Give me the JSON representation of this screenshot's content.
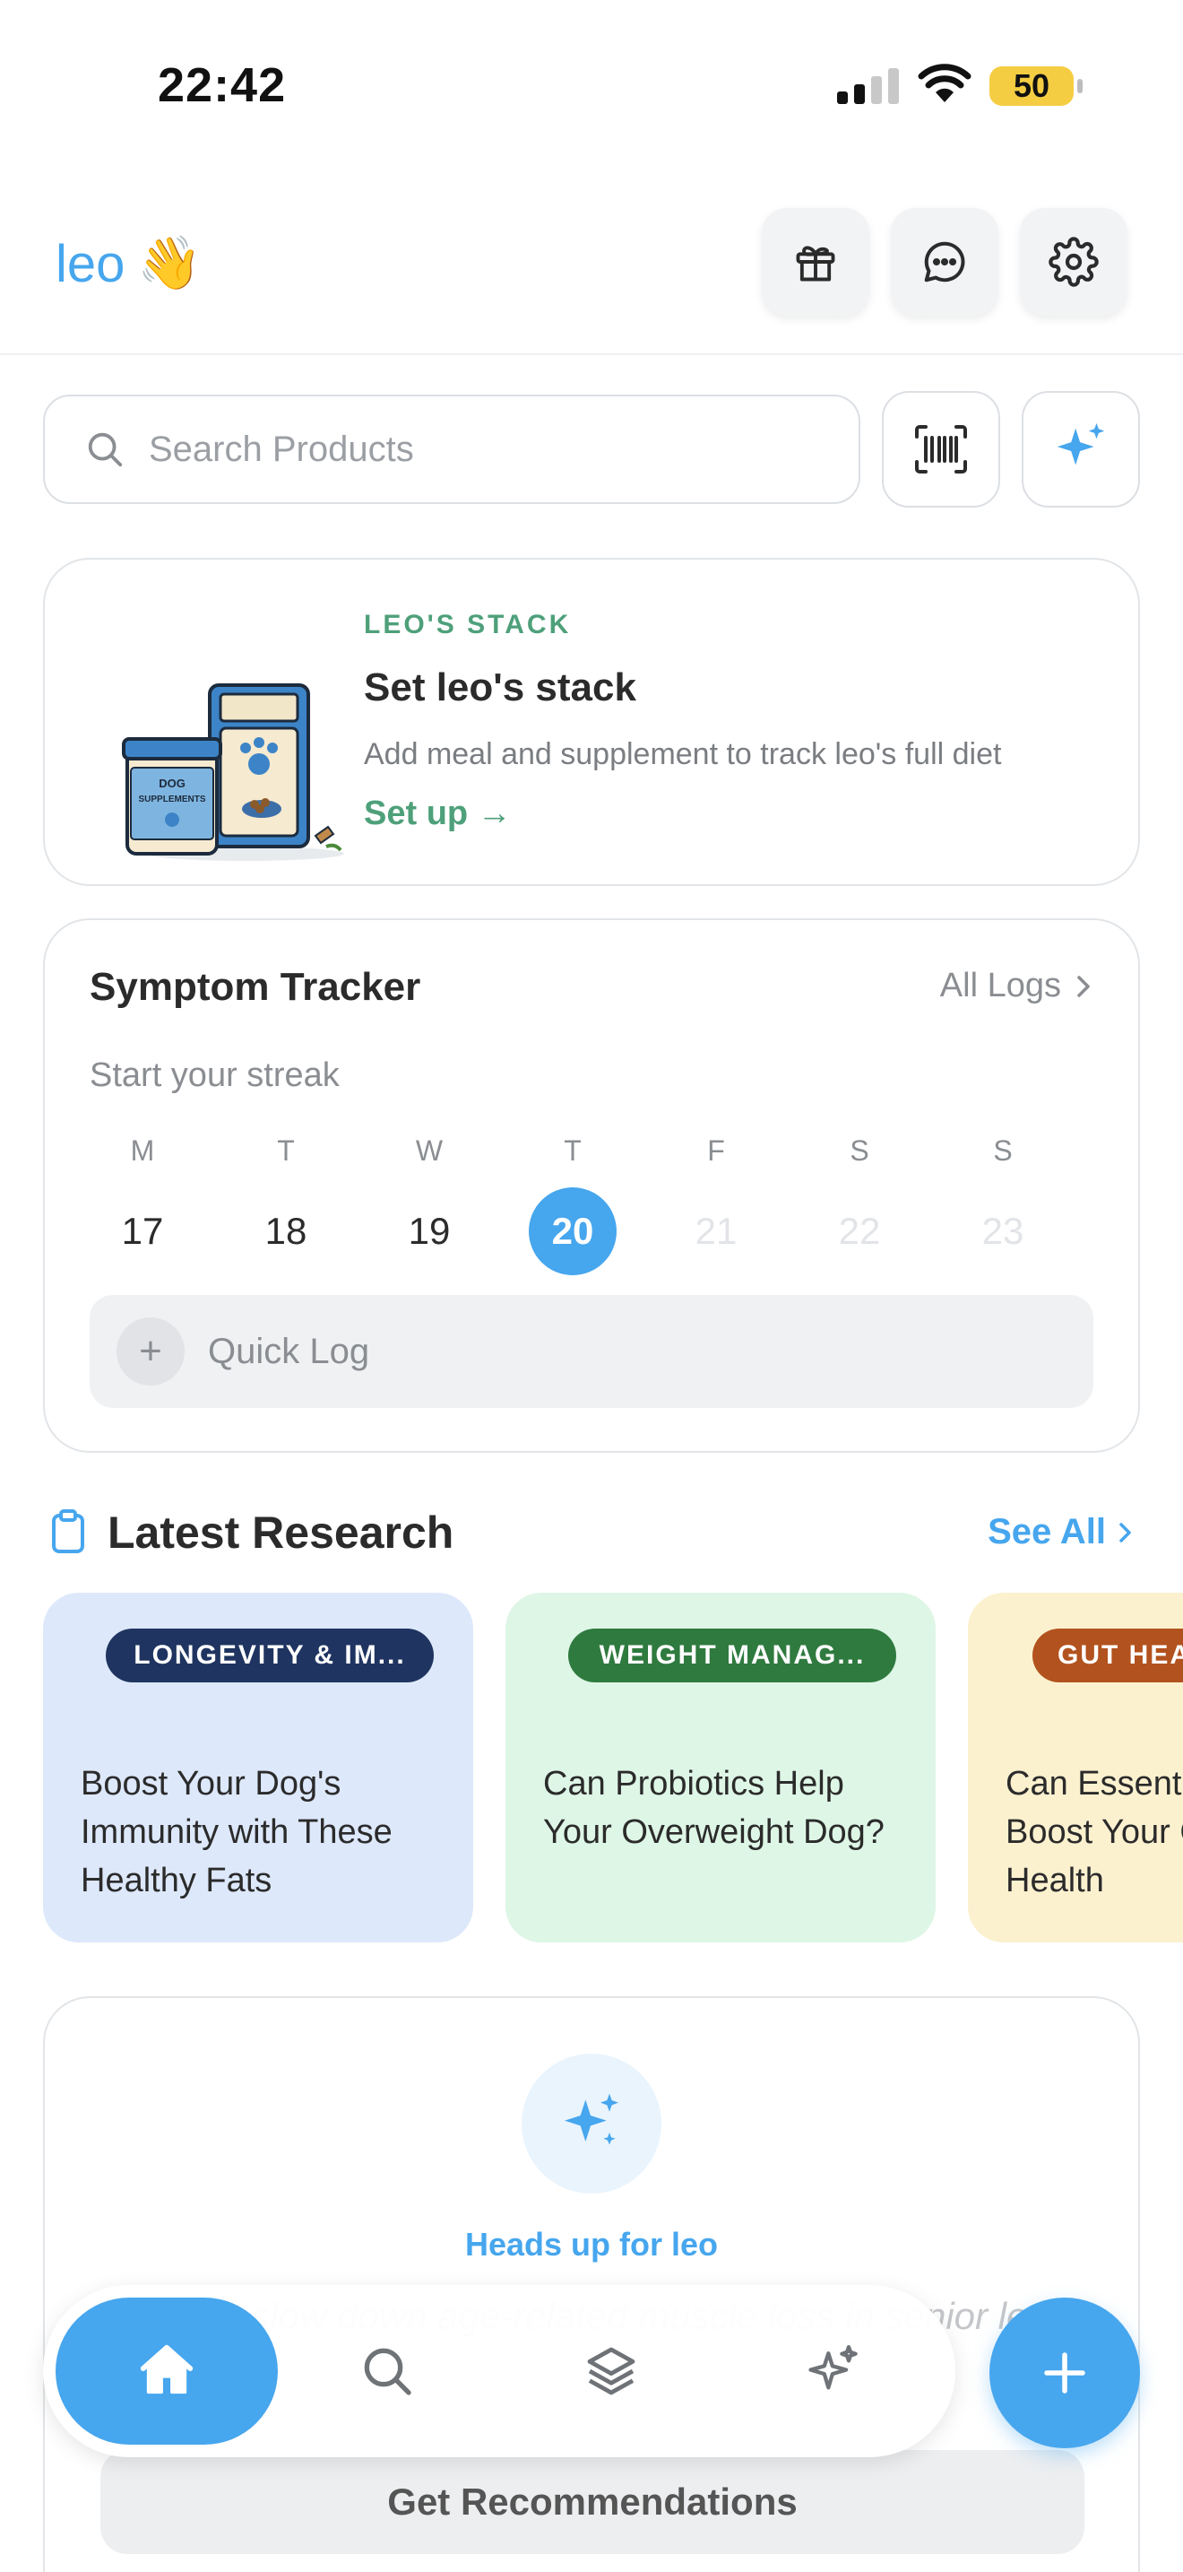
{
  "status_bar": {
    "time": "22:42",
    "battery": "50"
  },
  "header": {
    "name": "leo",
    "wave_emoji": "👋"
  },
  "search": {
    "placeholder": "Search Products"
  },
  "stack_card": {
    "eyebrow": "LEO'S STACK",
    "title": "Set leo's stack",
    "description": "Add meal and supplement to track leo's full diet",
    "link": "Set up →",
    "image_label": "DOG SUPPLEMENTS"
  },
  "symptom_tracker": {
    "title": "Symptom Tracker",
    "all_logs": "All Logs",
    "subtitle": "Start your streak",
    "days": [
      {
        "dow": "M",
        "date": "17",
        "state": "past"
      },
      {
        "dow": "T",
        "date": "18",
        "state": "past"
      },
      {
        "dow": "W",
        "date": "19",
        "state": "past"
      },
      {
        "dow": "T",
        "date": "20",
        "state": "today"
      },
      {
        "dow": "F",
        "date": "21",
        "state": "future"
      },
      {
        "dow": "S",
        "date": "22",
        "state": "future"
      },
      {
        "dow": "S",
        "date": "23",
        "state": "future"
      }
    ],
    "quick_log": "Quick Log"
  },
  "research": {
    "title": "Latest Research",
    "see_all": "See All",
    "cards": [
      {
        "tag": "LONGEVITY & IM...",
        "title": "Boost Your Dog's Immunity with These Healthy Fats",
        "bg": "#dde8fb",
        "tag_bg": "#1f3460"
      },
      {
        "tag": "WEIGHT MANAG...",
        "title": "Can Probiotics Help Your Overweight Dog?",
        "bg": "#def6e6",
        "tag_bg": "#2f7a3f"
      },
      {
        "tag": "GUT HEA",
        "title": "Can Essent Boost Your Gut Health",
        "bg": "#fcf1cf",
        "tag_bg": "#b2521e"
      }
    ]
  },
  "heads_up": {
    "label": "Heads up for leo",
    "quote": "\"...foods slow down age-related muscle loss in senior leo?\"",
    "button": "Get Recommendations"
  },
  "colors": {
    "accent": "#46a6ee",
    "green": "#4ea07a"
  },
  "icons": {
    "header": [
      "gift-icon",
      "chat-icon",
      "gear-icon"
    ],
    "nav": [
      "home-icon",
      "search-icon",
      "layers-icon",
      "sparkles-icon"
    ],
    "fab": "plus-icon"
  }
}
